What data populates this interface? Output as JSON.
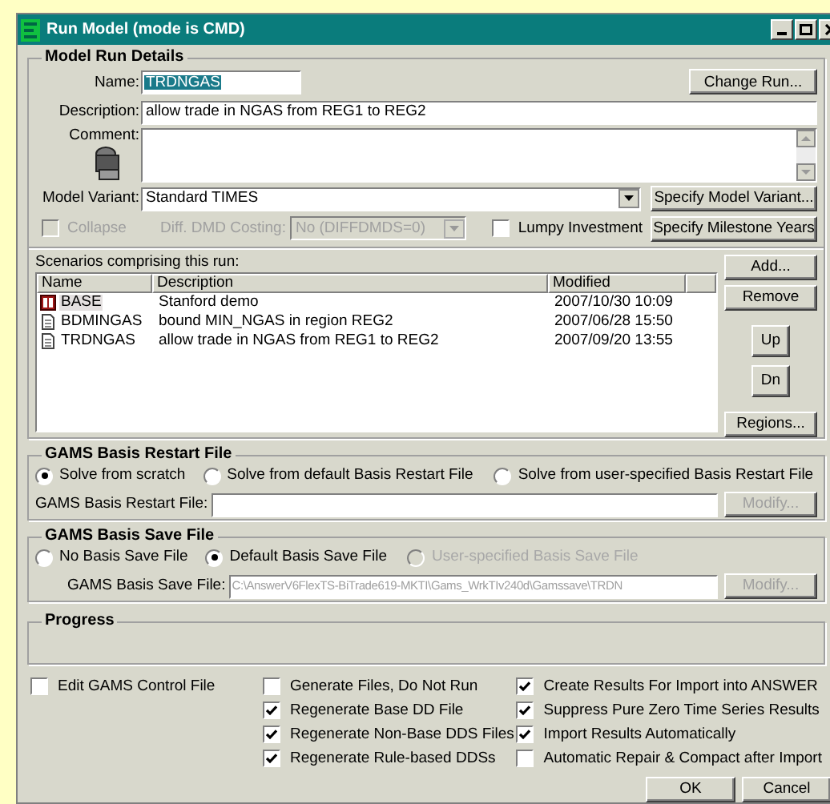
{
  "window": {
    "title": "Run Model (mode is CMD)"
  },
  "model_run_details": {
    "title": "Model Run Details",
    "name": {
      "label": "Name:",
      "value": "TRDNGAS"
    },
    "change_run_button": "Change Run...",
    "description": {
      "label": "Description:",
      "value": "allow trade in NGAS from REG1 to REG2"
    },
    "comment": {
      "label": "Comment:"
    },
    "model_variant": {
      "label": "Model Variant:",
      "value": "Standard TIMES"
    },
    "specify_model_variant_button": "Specify Model Variant...",
    "collapse": {
      "label": "Collapse",
      "checked": false,
      "disabled": true
    },
    "diff_dmd_costing": {
      "label": "Diff. DMD Costing:",
      "value": "No (DIFFDMDS=0)",
      "disabled": true
    },
    "lumpy_investment": {
      "label": "Lumpy Investment",
      "checked": false
    },
    "specify_milestone_years_button": "Specify Milestone Years"
  },
  "scenarios": {
    "label": "Scenarios comprising this run:",
    "columns": [
      "Name",
      "Description",
      "Modified"
    ],
    "rows": [
      {
        "kind": "base",
        "name": "BASE",
        "description": "Stanford demo",
        "modified": "2007/10/30 10:09",
        "selected": true
      },
      {
        "kind": "file",
        "name": "BDMINGAS",
        "description": "bound MIN_NGAS in region REG2",
        "modified": "2007/06/28 15:50",
        "selected": false
      },
      {
        "kind": "file",
        "name": "TRDNGAS",
        "description": "allow trade in NGAS from REG1 to REG2",
        "modified": "2007/09/20 13:55",
        "selected": false
      }
    ],
    "buttons": [
      "Add...",
      "Remove",
      "Up",
      "Dn",
      "Regions..."
    ]
  },
  "gams_basis_restart_file": {
    "title": "GAMS Basis Restart File",
    "options": [
      {
        "label": "Solve from scratch",
        "selected": true,
        "disabled": false
      },
      {
        "label": "Solve from default Basis Restart File",
        "selected": false,
        "disabled": false
      },
      {
        "label": "Solve from user-specified Basis Restart File",
        "selected": false,
        "disabled": false
      }
    ],
    "file_label": "GAMS Basis Restart File:",
    "modify_button": {
      "label": "Modify...",
      "disabled": true
    }
  },
  "gams_basis_save_file": {
    "title": "GAMS Basis Save File",
    "options": [
      {
        "label": "No Basis Save File",
        "selected": false,
        "disabled": false
      },
      {
        "label": "Default Basis Save File",
        "selected": true,
        "disabled": false
      },
      {
        "label": "User-specified Basis Save File",
        "selected": false,
        "disabled": true
      }
    ],
    "file_label": "GAMS Basis Save File:",
    "file_value": "C:\\AnswerV6FlexTS-BiTrade619-MKTI\\Gams_WrkTIv240d\\Gamssave\\TRDN",
    "modify_button": {
      "label": "Modify...",
      "disabled": true
    }
  },
  "progress": {
    "title": "Progress"
  },
  "options": [
    [
      {
        "label": "Edit GAMS Control File",
        "checked": false
      }
    ],
    [
      {
        "label": "Generate Files, Do Not Run",
        "checked": false
      },
      {
        "label": "Regenerate Base DD File",
        "checked": true
      },
      {
        "label": "Regenerate Non-Base DDS Files",
        "checked": true
      },
      {
        "label": "Regenerate Rule-based DDSs",
        "checked": true
      }
    ],
    [
      {
        "label": "Create Results For Import into ANSWER",
        "checked": true
      },
      {
        "label": "Suppress Pure Zero Time Series Results",
        "checked": true
      },
      {
        "label": "Import Results Automatically",
        "checked": true
      },
      {
        "label": "Automatic Repair & Compact after Import",
        "checked": false
      }
    ]
  ],
  "buttons": [
    "OK",
    "Cancel"
  ]
}
